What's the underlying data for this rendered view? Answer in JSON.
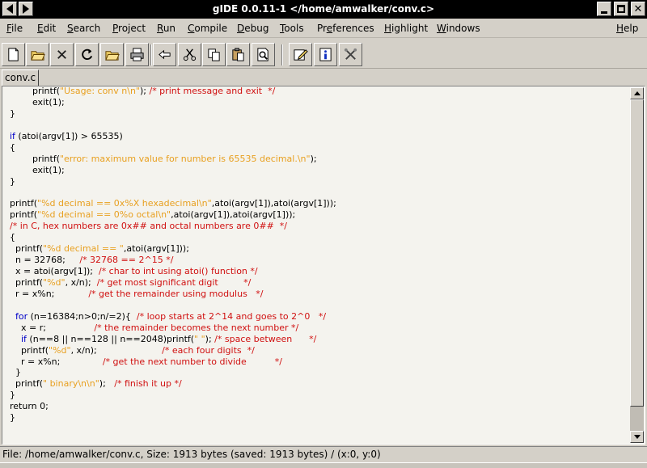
{
  "window": {
    "title": "gIDE 0.0.11-1 </home/amwalker/conv.c>"
  },
  "menu": [
    {
      "pre": "",
      "u": "F",
      "post": "ile"
    },
    {
      "pre": "",
      "u": "E",
      "post": "dit"
    },
    {
      "pre": "",
      "u": "S",
      "post": "earch"
    },
    {
      "pre": "",
      "u": "P",
      "post": "roject"
    },
    {
      "pre": "",
      "u": "R",
      "post": "un"
    },
    {
      "pre": "",
      "u": "C",
      "post": "ompile"
    },
    {
      "pre": "",
      "u": "D",
      "post": "ebug"
    },
    {
      "pre": "",
      "u": "T",
      "post": "ools"
    },
    {
      "pre": "Pr",
      "u": "e",
      "post": "ferences"
    },
    {
      "pre": "",
      "u": "H",
      "post": "ighlight"
    },
    {
      "pre": "",
      "u": "W",
      "post": "indows"
    },
    {
      "pre": "",
      "u": "H",
      "post": "elp"
    }
  ],
  "toolbar": {
    "buttons": [
      {
        "icon": "new-file-icon"
      },
      {
        "icon": "open-folder-icon"
      },
      {
        "icon": "close-icon"
      },
      {
        "icon": "reload-icon"
      },
      {
        "icon": "open-folder-2-icon"
      },
      {
        "icon": "print-icon"
      },
      {
        "icon": "undo-icon"
      },
      {
        "icon": "cut-icon"
      },
      {
        "icon": "copy-icon"
      },
      {
        "icon": "paste-icon"
      },
      {
        "icon": "print-preview-icon"
      },
      {
        "icon": "edit-icon"
      },
      {
        "icon": "info-icon"
      },
      {
        "icon": "tools-icon"
      }
    ]
  },
  "tabs": [
    {
      "label": "conv.c"
    }
  ],
  "colors": {
    "keyword": "#0000c8",
    "string": "#e8a020",
    "comment": "#d01010",
    "default": "#000000"
  },
  "editor": {
    "lines": [
      [
        [
          "t",
          "        printf("
        ],
        [
          "s",
          "\"Usage: conv n\\n\""
        ],
        [
          "t",
          "); "
        ],
        [
          "c",
          "/* print message and exit  */"
        ]
      ],
      [
        [
          "t",
          "        exit(1);"
        ]
      ],
      [
        [
          "t",
          "}"
        ]
      ],
      [
        [
          "t",
          ""
        ]
      ],
      [
        [
          "k",
          "if"
        ],
        [
          "t",
          " (atoi(argv[1]) > 65535)"
        ]
      ],
      [
        [
          "t",
          "{"
        ]
      ],
      [
        [
          "t",
          "        printf("
        ],
        [
          "s",
          "\"error: maximum value for number is 65535 decimal.\\n\""
        ],
        [
          "t",
          ");"
        ]
      ],
      [
        [
          "t",
          "        exit(1);"
        ]
      ],
      [
        [
          "t",
          "}"
        ]
      ],
      [
        [
          "t",
          ""
        ]
      ],
      [
        [
          "t",
          "printf("
        ],
        [
          "s",
          "\"%d decimal == 0x%X hexadecimal\\n\""
        ],
        [
          "t",
          ",atoi(argv[1]),atoi(argv[1]));"
        ]
      ],
      [
        [
          "t",
          "printf("
        ],
        [
          "s",
          "\"%d decimal == 0%o octal\\n\""
        ],
        [
          "t",
          ",atoi(argv[1]),atoi(argv[1]));"
        ]
      ],
      [
        [
          "c",
          "/* in C, hex numbers are 0x## and octal numbers are 0##  */"
        ]
      ],
      [
        [
          "t",
          "{"
        ]
      ],
      [
        [
          "t",
          "  printf("
        ],
        [
          "s",
          "\"%d decimal == \""
        ],
        [
          "t",
          ",atoi(argv[1]));"
        ]
      ],
      [
        [
          "t",
          "  n = 32768;     "
        ],
        [
          "c",
          "/* 32768 == 2^15 */"
        ]
      ],
      [
        [
          "t",
          "  x = atoi(argv[1]);  "
        ],
        [
          "c",
          "/* char to int using atoi() function */"
        ]
      ],
      [
        [
          "t",
          "  printf("
        ],
        [
          "s",
          "\"%d\""
        ],
        [
          "t",
          ", x/n);  "
        ],
        [
          "c",
          "/* get most significant digit         */"
        ]
      ],
      [
        [
          "t",
          "  r = x%n;            "
        ],
        [
          "c",
          "/* get the remainder using modulus   */"
        ]
      ],
      [
        [
          "t",
          ""
        ]
      ],
      [
        [
          "t",
          "  "
        ],
        [
          "k",
          "for"
        ],
        [
          "t",
          " (n=16384;n>0;n/=2){  "
        ],
        [
          "c",
          "/* loop starts at 2^14 and goes to 2^0   */"
        ]
      ],
      [
        [
          "t",
          "    x = r;                 "
        ],
        [
          "c",
          "/* the remainder becomes the next number */"
        ]
      ],
      [
        [
          "t",
          "    "
        ],
        [
          "k",
          "if"
        ],
        [
          "t",
          " (n==8 || n==128 || n==2048)printf("
        ],
        [
          "s",
          "\" \""
        ],
        [
          "t",
          "); "
        ],
        [
          "c",
          "/* space between      */"
        ]
      ],
      [
        [
          "t",
          "    printf("
        ],
        [
          "s",
          "\"%d\""
        ],
        [
          "t",
          ", x/n);                       "
        ],
        [
          "c",
          "/* each four digits  */"
        ]
      ],
      [
        [
          "t",
          "    r = x%n;               "
        ],
        [
          "c",
          "/* get the next number to divide          */"
        ]
      ],
      [
        [
          "t",
          "  }"
        ]
      ],
      [
        [
          "t",
          "  printf("
        ],
        [
          "s",
          "\" binary\\n\\n\""
        ],
        [
          "t",
          ");   "
        ],
        [
          "c",
          "/* finish it up */"
        ]
      ],
      [
        [
          "t",
          "}"
        ]
      ],
      [
        [
          "t",
          "return 0;"
        ]
      ],
      [
        [
          "t",
          "}"
        ]
      ],
      [
        [
          "t",
          ""
        ]
      ]
    ]
  },
  "statusbar": {
    "text": "File: /home/amwalker/conv.c, Size: 1913 bytes (saved: 1913 bytes) / (x:0, y:0)"
  }
}
